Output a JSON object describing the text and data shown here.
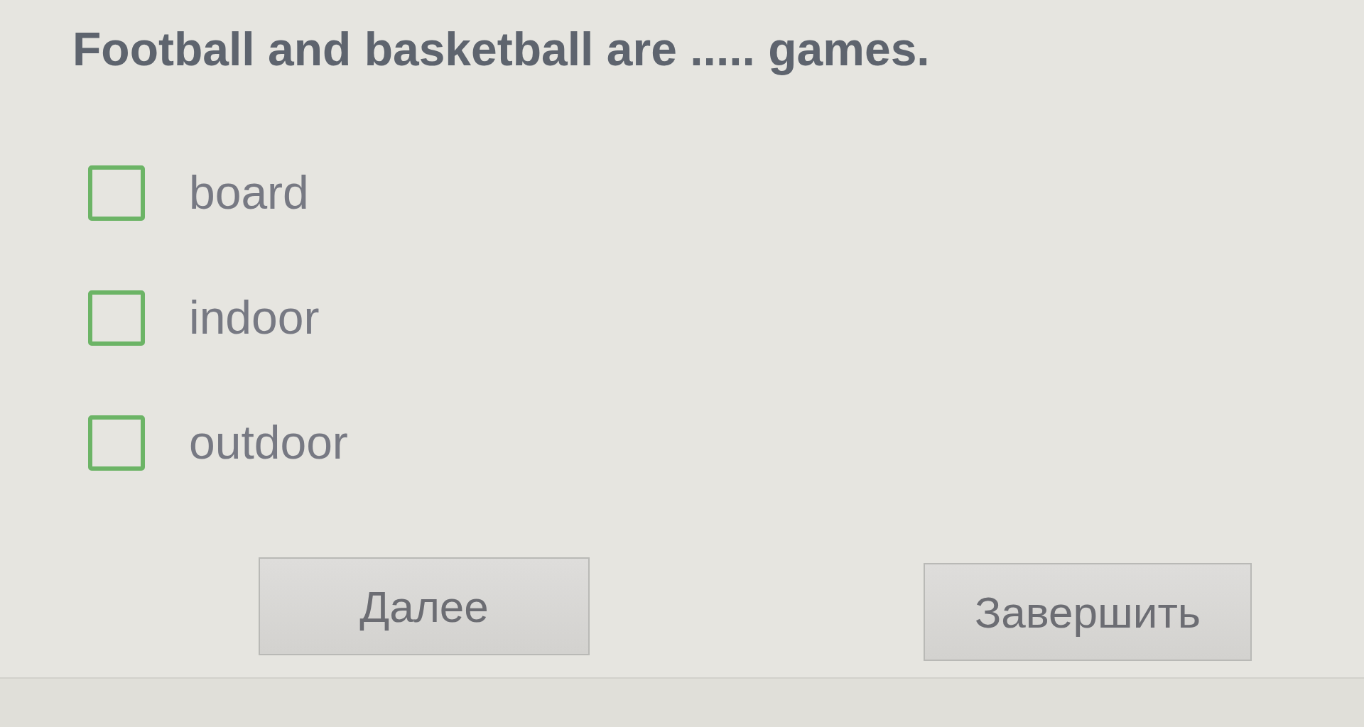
{
  "question": "Football and basketball are ..... games.",
  "options": [
    {
      "label": "board",
      "checked": false
    },
    {
      "label": "indoor",
      "checked": false
    },
    {
      "label": "outdoor",
      "checked": false
    }
  ],
  "buttons": [
    "Далее",
    "Завершить"
  ]
}
